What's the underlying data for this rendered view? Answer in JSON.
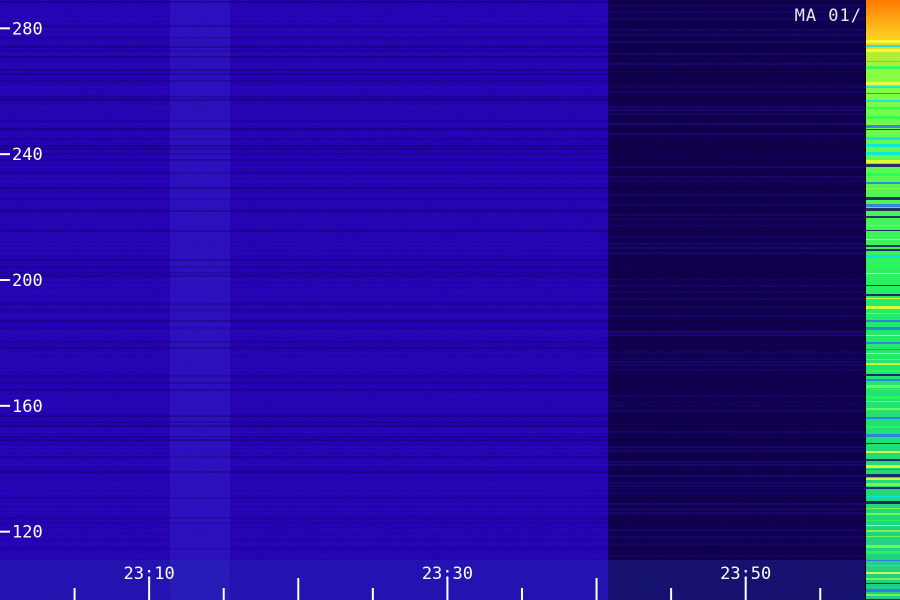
{
  "chart_data": {
    "type": "heatmap",
    "label": "MA 01/",
    "y_ticks": [
      120,
      160,
      200,
      240,
      280
    ],
    "x_tick_labels": [
      "23:10",
      "23:30",
      "23:50"
    ],
    "x_range": [
      "23:00",
      "23:58"
    ],
    "y_range": [
      111,
      289
    ],
    "colormap": [
      "#000000",
      "#1a0066",
      "#3a22cc",
      "#2f6bff",
      "#00e0ff",
      "#22ff55",
      "#ffff33",
      "#ff6a00",
      "#ff1a1a"
    ],
    "colors": {
      "tick": "#ffffff",
      "text": "#ffffff"
    }
  }
}
